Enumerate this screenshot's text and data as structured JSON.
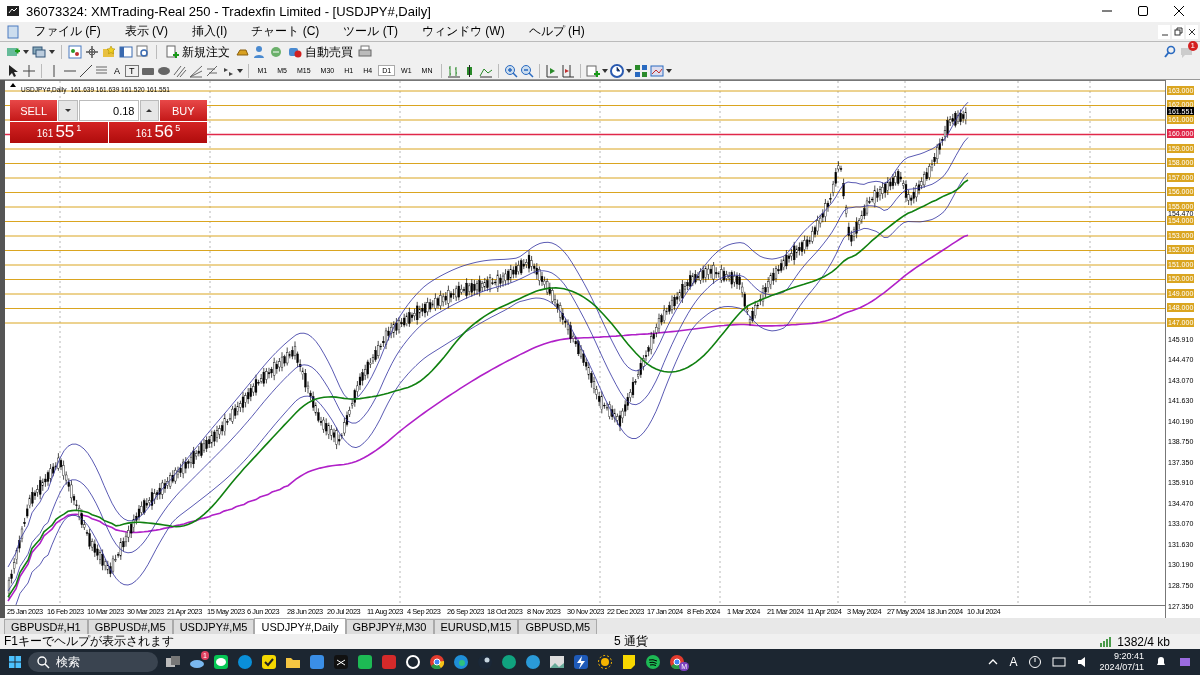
{
  "window": {
    "title": "36073324: XMTrading-Real 250 - Tradexfin Limited - [USDJPY#,Daily]"
  },
  "menu": [
    "ファイル (F)",
    "表示 (V)",
    "挿入(I)",
    "チャート (C)",
    "ツール (T)",
    "ウィンドウ (W)",
    "ヘルプ (H)"
  ],
  "toolbar": {
    "new_order": "新規注文",
    "auto_trading": "自動売買",
    "notification_badge": "1"
  },
  "drawing_tools": {
    "text_label": "A",
    "text_box": "T"
  },
  "timeframes": [
    {
      "label": "M1",
      "selected": false
    },
    {
      "label": "M5",
      "selected": false
    },
    {
      "label": "M15",
      "selected": false
    },
    {
      "label": "M30",
      "selected": false
    },
    {
      "label": "H1",
      "selected": false
    },
    {
      "label": "H4",
      "selected": false
    },
    {
      "label": "D1",
      "selected": true
    },
    {
      "label": "W1",
      "selected": false
    },
    {
      "label": "MN",
      "selected": false
    }
  ],
  "chart": {
    "symbol": "USDJPY#,Daily",
    "ohlc": "161.639 161.639 161.520 161.551"
  },
  "trade_panel": {
    "sell_label": "SELL",
    "buy_label": "BUY",
    "volume": "0.18",
    "sell_price": {
      "big": "161",
      "pips": "55",
      "point": "1"
    },
    "buy_price": {
      "big": "161",
      "pips": "56",
      "point": "5"
    }
  },
  "price_levels": [
    {
      "label": "163.000",
      "kind": "level",
      "color": "#daa520"
    },
    {
      "label": "162.000",
      "kind": "level",
      "color": "#daa520"
    },
    {
      "label": "161.551",
      "kind": "current",
      "color": "#000000"
    },
    {
      "label": "161.000",
      "kind": "level",
      "color": "#daa520"
    },
    {
      "label": "160.000",
      "kind": "level",
      "color": "#e0284a"
    },
    {
      "label": "159.000",
      "kind": "level",
      "color": "#daa520"
    },
    {
      "label": "158.000",
      "kind": "level",
      "color": "#daa520"
    },
    {
      "label": "157.000",
      "kind": "level",
      "color": "#daa520"
    },
    {
      "label": "156.000",
      "kind": "level",
      "color": "#daa520"
    },
    {
      "label": "155.000",
      "kind": "level",
      "color": "#daa520"
    },
    {
      "label": "154.000",
      "kind": "level",
      "color": "#daa520"
    },
    {
      "label": "153.000",
      "kind": "level",
      "color": "#daa520"
    },
    {
      "label": "152.000",
      "kind": "level",
      "color": "#daa520"
    },
    {
      "label": "151.000",
      "kind": "level",
      "color": "#daa520"
    },
    {
      "label": "150.000",
      "kind": "level",
      "color": "#daa520"
    },
    {
      "label": "149.000",
      "kind": "level",
      "color": "#daa520"
    },
    {
      "label": "148.000",
      "kind": "level",
      "color": "#daa520"
    },
    {
      "label": "147.000",
      "kind": "level",
      "color": "#daa520"
    }
  ],
  "upper_tick": "154.470",
  "price_ticks": [
    "145.910",
    "144.470",
    "143.070",
    "141.630",
    "140.190",
    "138.750",
    "137.350",
    "135.910",
    "134.470",
    "133.070",
    "131.630",
    "130.190",
    "128.750",
    "127.350"
  ],
  "date_labels": [
    "25 Jan 2023",
    "16 Feb 2023",
    "10 Mar 2023",
    "30 Mar 2023",
    "21 Apr 2023",
    "15 May 2023",
    "6 Jun 2023",
    "28 Jun 2023",
    "20 Jul 2023",
    "11 Aug 2023",
    "4 Sep 2023",
    "26 Sep 2023",
    "18 Oct 2023",
    "8 Nov 2023",
    "30 Nov 2023",
    "22 Dec 2023",
    "17 Jan 2024",
    "8 Feb 2024",
    "1 Mar 2024",
    "21 Mar 2024",
    "11 Apr 2024",
    "3 May 2024",
    "27 May 2024",
    "18 Jun 2024",
    "10 Jul 2024"
  ],
  "tabs": [
    {
      "label": "GBPUSD#,H1",
      "selected": false
    },
    {
      "label": "GBPUSD#,M5",
      "selected": false
    },
    {
      "label": "USDJPY#,M5",
      "selected": false
    },
    {
      "label": "USDJPY#,Daily",
      "selected": true
    },
    {
      "label": "GBPJPY#,M30",
      "selected": false
    },
    {
      "label": "EURUSD,M15",
      "selected": false
    },
    {
      "label": "GBPUSD,M5",
      "selected": false
    }
  ],
  "status_bar": {
    "help": "F1キーでヘルプが表示されます",
    "symbols": "5 通貨",
    "traffic": "1382/4 kb"
  },
  "taskbar": {
    "search_placeholder": "検索",
    "weather_badge": "1",
    "profile_badge": "M",
    "ime": "A",
    "time": "9:20:41",
    "date": "2024/07/11"
  }
}
